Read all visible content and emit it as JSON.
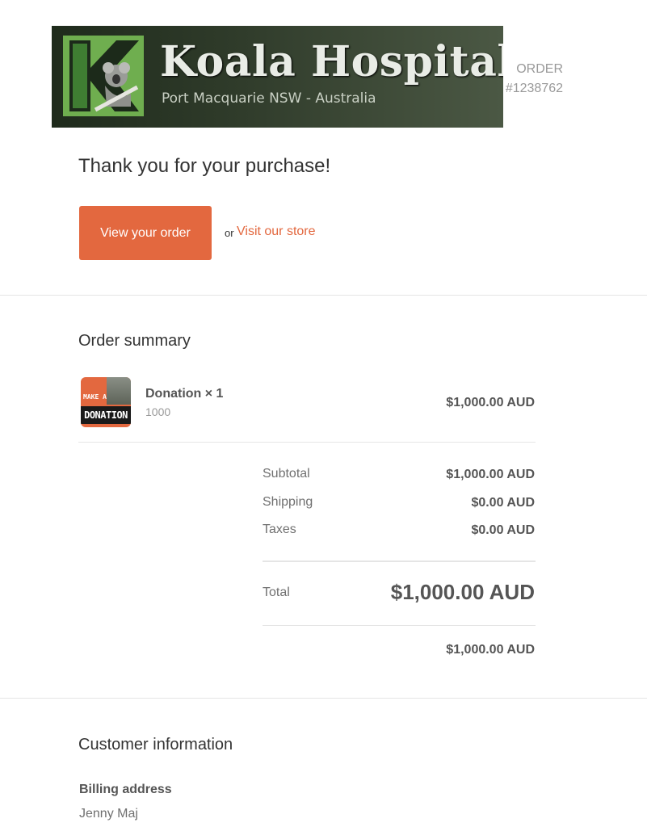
{
  "header": {
    "logo_letter": "K",
    "banner_title": "Koala Hospital",
    "banner_subtitle": "Port Macquarie NSW - Australia",
    "order_label": "ORDER",
    "order_number": "#1238762"
  },
  "confirmation": {
    "title": "Thank you for your purchase!",
    "view_order_label": "View your order",
    "or_text": "or",
    "store_link_label": "Visit our store"
  },
  "order_summary": {
    "title": "Order summary",
    "items": [
      {
        "image_text_top": "MAKE A",
        "image_text_bottom": "DONATION",
        "name": "Donation × 1",
        "variant": "1000",
        "price": "$1,000.00 AUD"
      }
    ],
    "subtotal_label": "Subtotal",
    "subtotal_value": "$1,000.00 AUD",
    "shipping_label": "Shipping",
    "shipping_value": "$0.00 AUD",
    "taxes_label": "Taxes",
    "taxes_value": "$0.00 AUD",
    "total_label": "Total",
    "total_value": "$1,000.00 AUD",
    "paid_value": "$1,000.00 AUD"
  },
  "customer": {
    "title": "Customer information",
    "billing_label": "Billing address",
    "billing_name": "Jenny Maj"
  },
  "colors": {
    "accent": "#e3683f",
    "banner_dark": "#2f3b2a"
  }
}
